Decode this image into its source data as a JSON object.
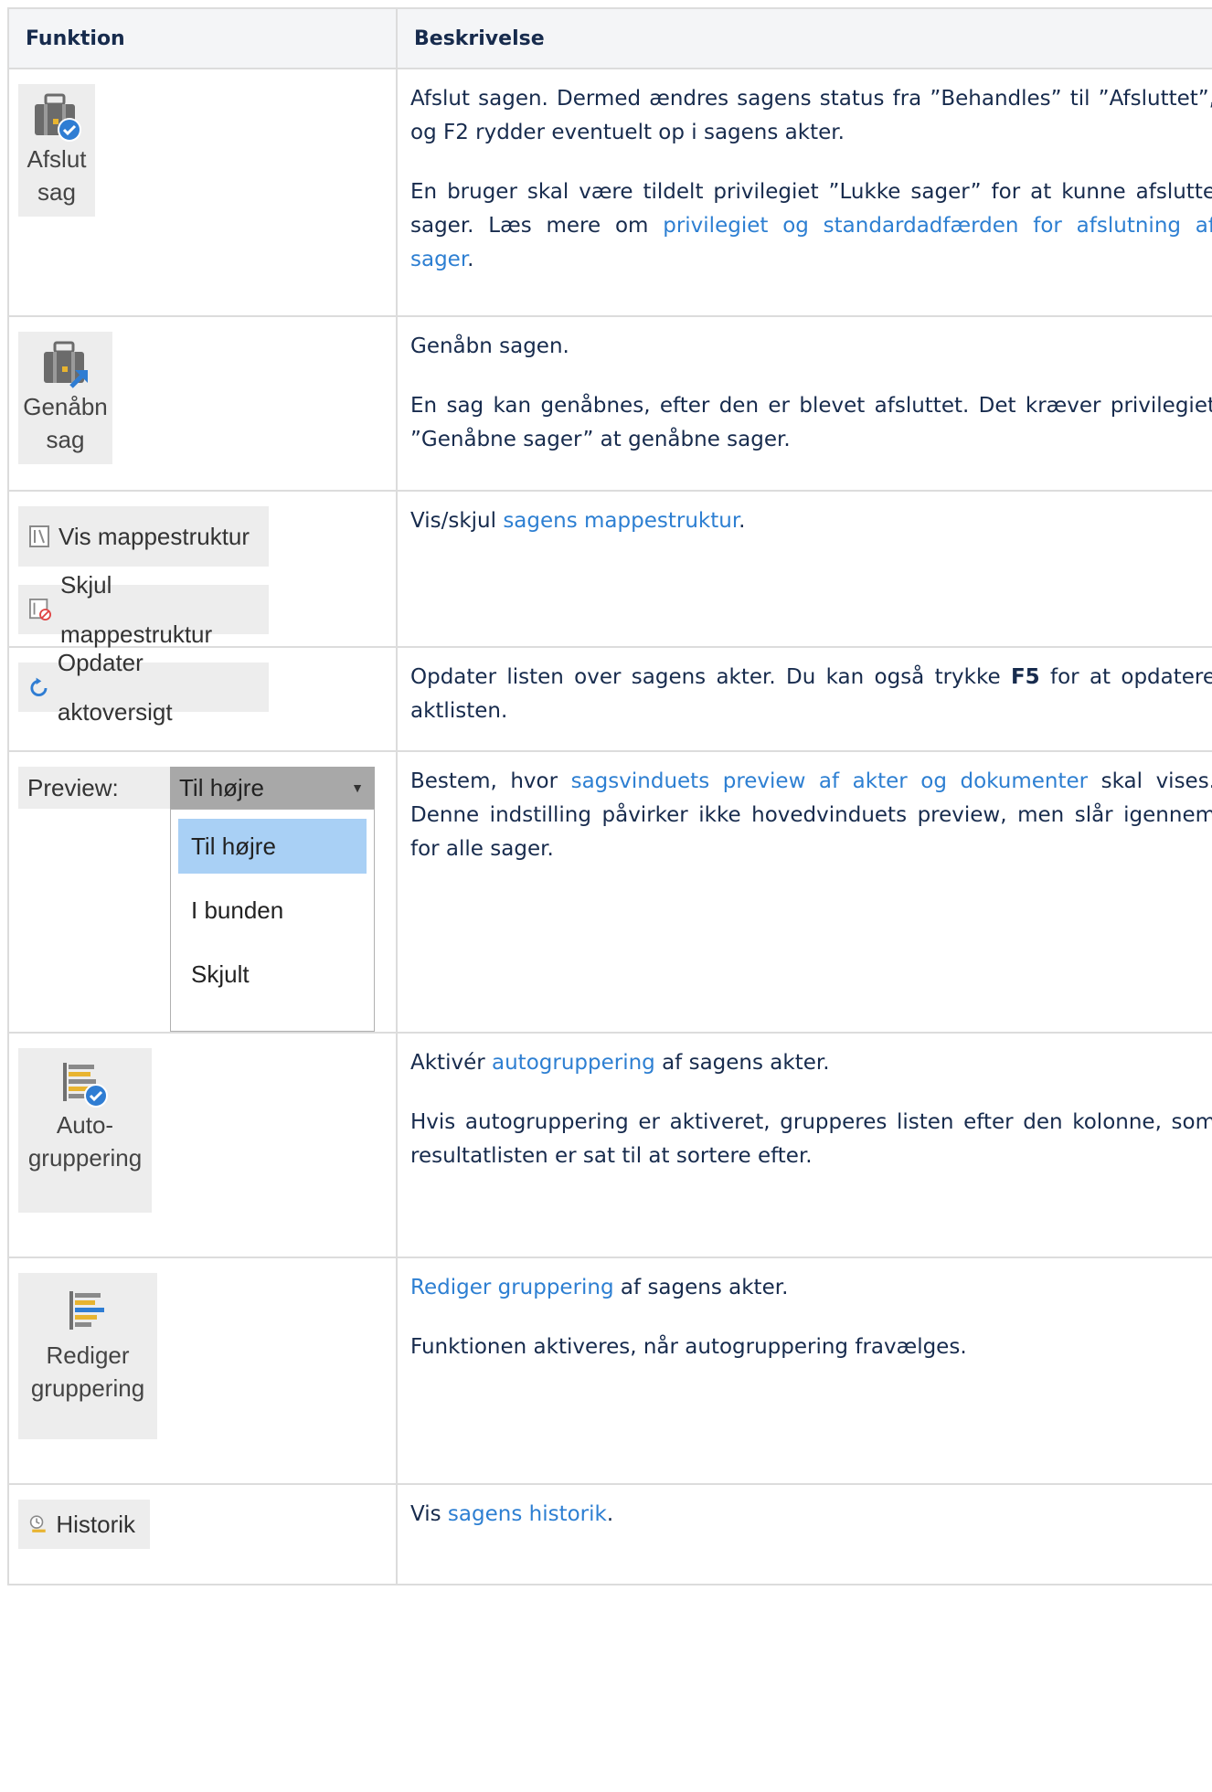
{
  "table": {
    "headers": [
      "Funktion",
      "Beskrivelse"
    ]
  },
  "rows": {
    "close_case": {
      "button": [
        "Afslut",
        "sag"
      ],
      "p1": "Afslut sagen. Dermed ændres sagens status fra ”Behandles” til ”Afsluttet”, og F2 rydder eventuelt op i sagens akter.",
      "p2_pre": "En bruger skal være tildelt privilegiet ”Lukke sager” for at kunne afslutte sager. Læs mere om ",
      "p2_link": "privilegiet og standardadfærden for afslutning af sager",
      "p2_post": "."
    },
    "reopen_case": {
      "button": [
        "Genåbn",
        "sag"
      ],
      "p1": "Genåbn sagen.",
      "p2": "En sag kan genåbnes, efter den er blevet afsluttet. Det kræver privilegiet ”Genåbne sager” at genåbne sager."
    },
    "folder_structure": {
      "show_label": "Vis mappestruktur",
      "hide_label": "Skjul mappestruktur",
      "p1_pre": "Vis/skjul ",
      "p1_link": "sagens mappestruktur",
      "p1_post": "."
    },
    "refresh": {
      "button": "Opdater aktoversigt",
      "p1_pre": "Opdater listen over sagens akter. Du kan også trykke ",
      "p1_bold": "F5",
      "p1_post": " for at opdatere aktlisten."
    },
    "preview": {
      "label": "Preview:",
      "selected": "Til højre",
      "options": [
        "Til højre",
        "I bunden",
        "Skjult"
      ],
      "p1_pre": "Bestem, hvor ",
      "p1_link": "sagsvinduets preview af akter og dokumenter",
      "p1_post": " skal vises. Denne indstilling påvirker ikke hovedvinduets preview, men slår igennem for alle sager."
    },
    "autogroup": {
      "button": [
        "Auto-",
        "gruppering"
      ],
      "p1_pre": "Aktivér ",
      "p1_link": "autogruppering",
      "p1_post": " af sagens akter.",
      "p2": "Hvis autogruppering er aktiveret, grupperes listen efter den kolonne, som resultatlisten er sat til at sortere efter."
    },
    "edit_grouping": {
      "button": [
        "Rediger",
        "gruppering"
      ],
      "p1_link": "Rediger gruppering",
      "p1_post": " af sagens akter.",
      "p2": "Funktionen aktiveres, når autogruppering fravælges."
    },
    "history": {
      "button": "Historik",
      "p1_pre": "Vis ",
      "p1_link": "sagens historik",
      "p1_post": "."
    }
  },
  "colors": {
    "link": "#2d7fd2",
    "header_bg": "#f4f5f7",
    "border": "#dcdcdc",
    "button_bg": "#ededed",
    "selected_option": "#a9d0f5"
  }
}
